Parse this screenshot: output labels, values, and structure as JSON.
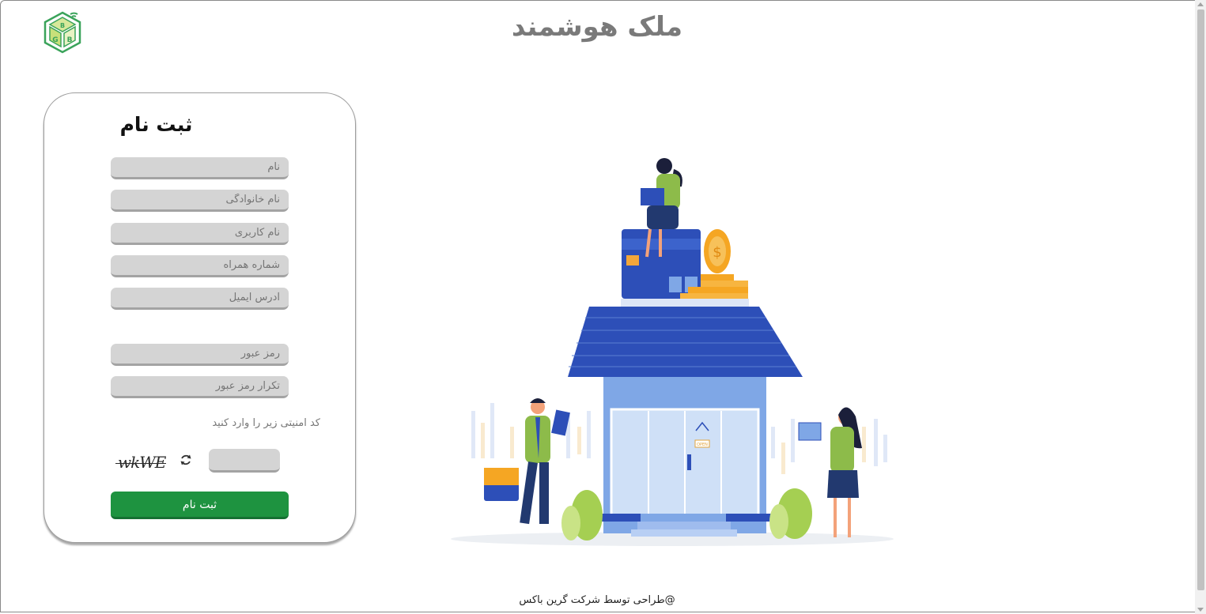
{
  "header": {
    "title": "ملک هوشمند"
  },
  "register_form": {
    "title": "ثبت نام",
    "fields": [
      {
        "placeholder": "نام"
      },
      {
        "placeholder": "نام خانوادگی"
      },
      {
        "placeholder": "نام کاربری"
      },
      {
        "placeholder": "شماره همراه"
      },
      {
        "placeholder": "آدرس ایمیل"
      },
      {
        "placeholder": "رمز عبور"
      },
      {
        "placeholder": "تکرار رمز عبور"
      }
    ],
    "captcha_hint": "کد امنیتی زیر را وارد کنید",
    "captcha_code": "wkWE",
    "captcha_input_value": "",
    "submit_label": "ثبت نام"
  },
  "illustration": {
    "door_sign": "OPEN"
  },
  "footer": {
    "text": "@طراحی توسط شرکت گرین باکس"
  },
  "colors": {
    "accent_green": "#1e9340",
    "title_gray": "#7a7a7a",
    "field_bg": "#d4d4d4",
    "roof_blue": "#2d4fb8",
    "shirt_green": "#8dbb4a"
  },
  "icons": {
    "logo": "smart-home-cube-logo",
    "refresh": "refresh-icon"
  }
}
